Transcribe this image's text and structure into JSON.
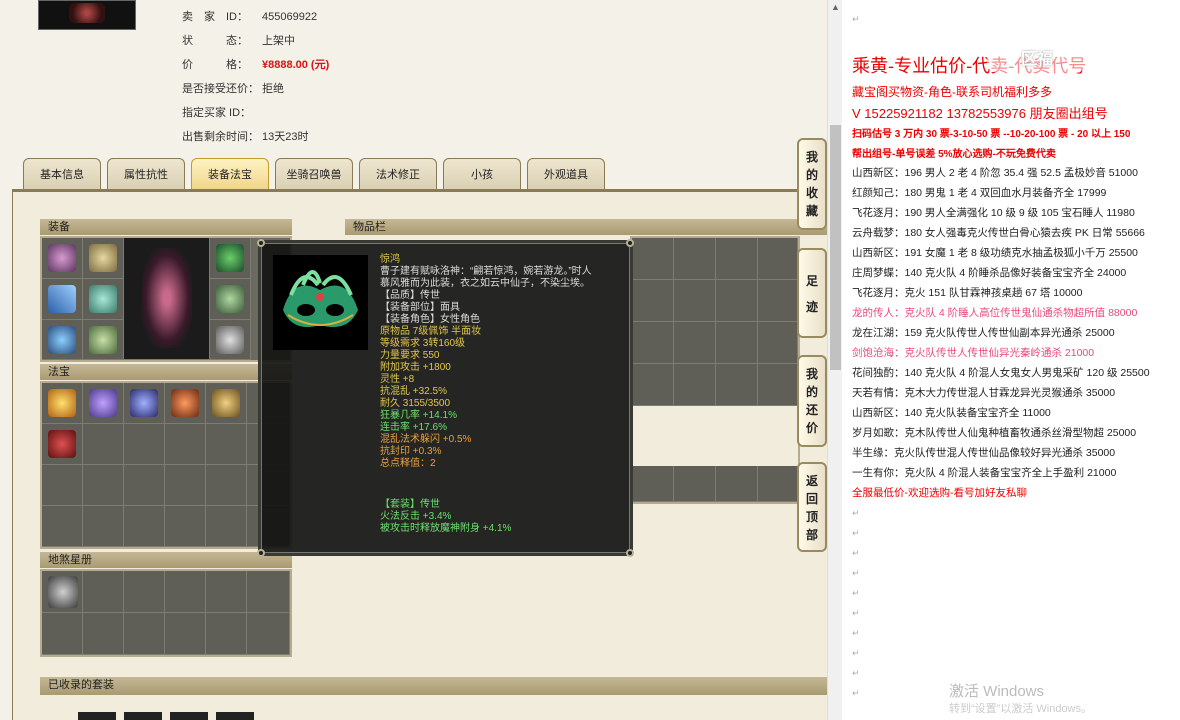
{
  "seller_info": {
    "rows": [
      {
        "label": "卖　家　ID：",
        "value": "455069922"
      },
      {
        "label": "状　　　态：",
        "value": "上架中"
      },
      {
        "label": "价　　　格：",
        "value": "¥8888.00 (元)"
      },
      {
        "label": "是否接受还价：",
        "value": "拒绝"
      },
      {
        "label": "指定买家 ID：",
        "value": ""
      },
      {
        "label": "出售剩余时间：",
        "value": "13天23时"
      }
    ]
  },
  "tabs": [
    "基本信息",
    "属性抗性",
    "装备法宝",
    "坐骑召唤兽",
    "法术修正",
    "小孩",
    "外观道具"
  ],
  "active_tab": "装备法宝",
  "sections": {
    "equipment": "装备",
    "inventory": "物品栏",
    "fabao": "法宝",
    "dishaxingce": "地煞星册",
    "collected_sets": "已收录的套装"
  },
  "tooltip": {
    "name": "惊鸿",
    "desc_1": "曹子建有赋咏洛神：“翩若惊鸿，婉若游龙。”时人",
    "desc_2": "慕风雅而为此装，衣之如云中仙子，不染尘埃。",
    "quality": "【品质】传世",
    "slot": "【装备部位】面具",
    "role": "【装备角色】女性角色",
    "origin": "原物品 7级佩饰 半面妆",
    "level_req": "等级需求 3转160级",
    "str_req": "力量要求 550",
    "atk": "附加攻击 +1800",
    "spirit": "灵性 +8",
    "resist": "抗混乱 +32.5%",
    "durability": "耐久 3155/3500",
    "crit": "狂暴几率 +14.1%",
    "combo": "连击率 +17.6%",
    "dodge": "混乱法术躲闪 +0.5%",
    "seal": "抗封印 +0.3%",
    "release": "总点释值：2",
    "set_title": "【套装】传世",
    "set_1": "火法反击 +3.4%",
    "set_2": "被攻击时释放魔神附身 +4.1%"
  },
  "side_buttons": [
    {
      "name": "my-favorites",
      "chars": [
        "我",
        "的",
        "收",
        "藏"
      ]
    },
    {
      "name": "footprints",
      "chars": [
        "足",
        "迹"
      ]
    },
    {
      "name": "my-counteroffer",
      "chars": [
        "我",
        "的",
        "还",
        "价"
      ]
    },
    {
      "name": "back-to-top",
      "chars": [
        "返",
        "回",
        "顶",
        "部"
      ]
    }
  ],
  "doc": {
    "title": "乘黄-专业估价-代卖-代卖代号",
    "logo_overlay": "区福",
    "sub": "藏宝阁买物资-角色-联系司机福利多多",
    "phone": "V 15225921182   13782553976 朋友圈出组号",
    "promo_1": "扫码估号 3 万内 30 票-3-10-50 票 --10-20-100 票 - 20 以上 150",
    "promo_2": "帮出组号-单号误差 5%放心选购-不玩免费代卖",
    "listings": [
      {
        "text": "山西新区：196 男人 2 老 4 阶忽 35.4 强 52.5 孟极妙音 51000",
        "style": "normal"
      },
      {
        "text": "红颜知己：180 男鬼 1 老 4 双回血水月装备齐全 17999",
        "style": "normal"
      },
      {
        "text": "飞花逐月：190 男人全满强化 10 级 9 级 105 宝石睡人 11980",
        "style": "normal"
      },
      {
        "text": "云舟载梦：180 女人强毒克火传世白骨心猿去疾 PK 日常 55666",
        "style": "normal"
      },
      {
        "text": "山西新区：191 女魔 1 老 8 级功绩克水抽孟极狐小千万 25500",
        "style": "normal"
      },
      {
        "text": "庄周梦蝶：140 克火队 4 阶睡杀品像好装备宝宝齐全 24000",
        "style": "normal"
      },
      {
        "text": "飞花逐月：克火 151 队甘霖神孩桌趟 67 塔 10000",
        "style": "normal"
      },
      {
        "text": "龙的传人：克火队 4 阶睡人高位传世鬼仙通杀物超所值 88000",
        "style": "pink"
      },
      {
        "text": "龙在江湖：159 克火队传世人传世仙副本异光通杀 25000",
        "style": "normal"
      },
      {
        "text": "剑饱沧海：克火队传世人传世仙异光秦岭通杀 21000",
        "style": "pink"
      },
      {
        "text": "花间独酌：140 克火队 4 阶混人女鬼女人男鬼采矿 120 级 25500",
        "style": "normal"
      },
      {
        "text": "天若有情：克木大力传世混人甘霖龙异光灵猴通杀 35000",
        "style": "normal"
      },
      {
        "text": "山西新区：140 克火队装备宝宝齐全 11000",
        "style": "normal"
      },
      {
        "text": "岁月如歌：克木队传世人仙鬼种植畜牧通杀丝滑型物超 25000",
        "style": "normal"
      },
      {
        "text": "半生缘：克火队传世混人传世仙品像较好异光通杀 35000",
        "style": "normal"
      },
      {
        "text": "一生有你：克火队 4 阶混人装备宝宝齐全上手盈利 21000",
        "style": "normal"
      },
      {
        "text": "全服最低价-欢迎选购-看号加好友私聊",
        "style": "red"
      }
    ],
    "watermark": "激活 Windows",
    "watermark_sub": "转到“设置”以激活 Windows。"
  }
}
